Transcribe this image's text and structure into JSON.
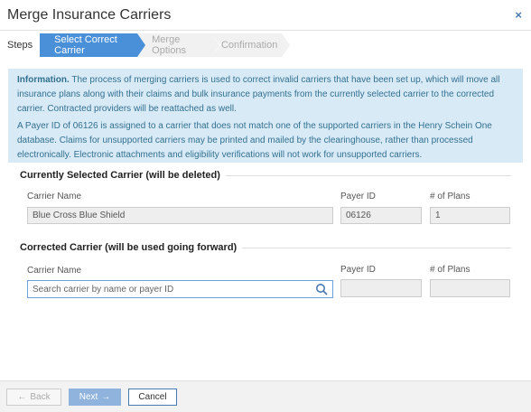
{
  "dialog": {
    "title": "Merge Insurance Carriers",
    "close_glyph": "×"
  },
  "steps": {
    "label": "Steps",
    "items": [
      {
        "label": "Select Correct Carrier",
        "state": "active"
      },
      {
        "label": "Merge Options",
        "state": "inactive"
      },
      {
        "label": "Confirmation",
        "state": "inactive"
      }
    ]
  },
  "info": {
    "lead": "Information.",
    "p1": " The process of merging carriers is used to correct invalid carriers that have been set up, which will move all insurance plans along with their claims and bulk insurance payments from the currently selected carrier to the corrected carrier. Contracted providers will be reattached as well.",
    "p2": "A Payer ID of 06126 is assigned to a carrier that does not match one of the supported carriers in the Henry Schein One database. Claims for unsupported carriers may be printed and mailed by the clearinghouse, rather than processed electronically. Electronic attachments and eligibility verifications will not work for unsupported carriers."
  },
  "current": {
    "title": "Currently Selected Carrier (will be deleted)",
    "carrier_label": "Carrier Name",
    "payer_label": "Payer ID",
    "plans_label": "# of Plans",
    "carrier_value": "Blue Cross Blue Shield",
    "payer_value": "06126",
    "plans_value": "1"
  },
  "corrected": {
    "title": "Corrected Carrier (will be used going forward)",
    "carrier_label": "Carrier Name",
    "payer_label": "Payer ID",
    "plans_label": "# of Plans",
    "search_placeholder": "Search carrier by name or payer ID",
    "payer_value": "",
    "plans_value": ""
  },
  "footer": {
    "back_label": "Back",
    "back_icon": "←",
    "next_label": "Next",
    "next_icon": "→",
    "cancel_label": "Cancel"
  },
  "colors": {
    "accent": "#4a90d9",
    "info_bg": "#d9eaf7",
    "info_text": "#31708f"
  }
}
